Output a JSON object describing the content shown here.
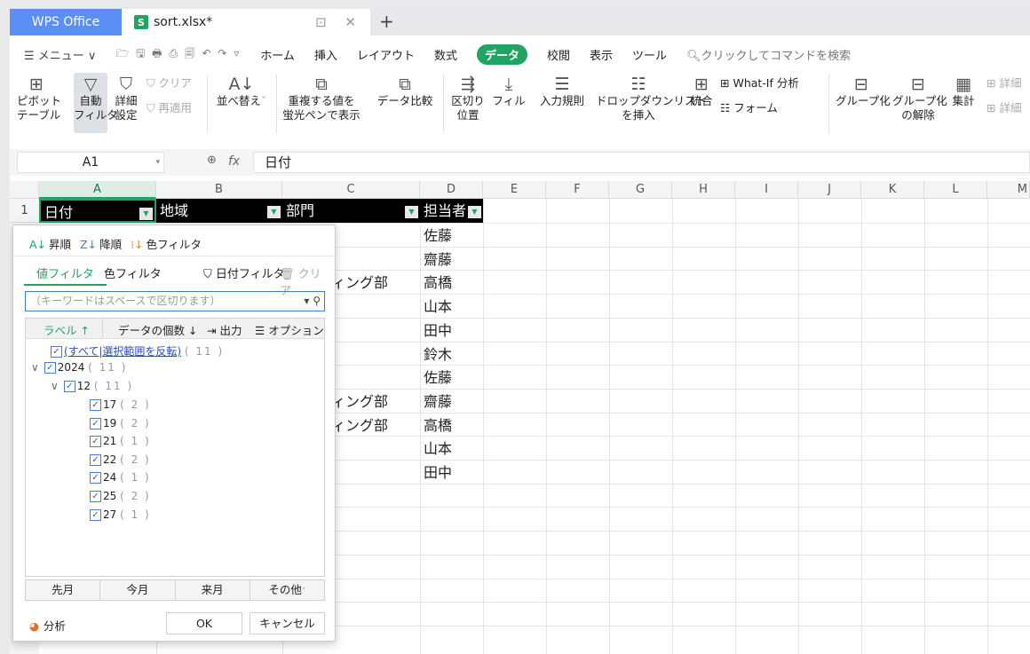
{
  "titlebar": {
    "app_tab": "WPS Office",
    "file_tab": "sort.xlsx*",
    "file_icon_letter": "S",
    "new_tab": "+",
    "tab_controls": "⊡ ✕"
  },
  "menu": {
    "menu_btn": "☰ メニュー ∨",
    "quick_icons": "🗁 🖫 🖶 ⎙ 🗐 ↶ ↷ ▿",
    "items": [
      "ホーム",
      "挿入",
      "レイアウト",
      "数式"
    ],
    "active": "データ",
    "items2": [
      "校閲",
      "表示",
      "ツール"
    ],
    "search": "クリックしてコマンドを検索"
  },
  "ribbon": {
    "pivot": "ピボット\nテーブル",
    "autofilter": "自動\nフィルタ",
    "detail": "詳細\n設定",
    "clear": "クリア",
    "reapply": "再適用",
    "sort": "並べ替え",
    "dup": "重複する値を\n蛍光ペンで表示",
    "compare": "データ比較",
    "split": "区切り\n位置",
    "fill": "フィル",
    "validation": "入力規則",
    "dropdown": "ドロップダウンリスト\nを挿入",
    "consolidate": "統合",
    "whatif": "What-If 分析",
    "form": "フォーム",
    "group": "グループ化",
    "ungroup": "グループ化\nの解除",
    "subtotal": "集計",
    "detail_r": "詳細"
  },
  "formula": {
    "cell": "A1",
    "fx": "fx",
    "value": "日付"
  },
  "columns": [
    "A",
    "B",
    "C",
    "D",
    "E",
    "F",
    "G",
    "H",
    "I",
    "J",
    "K",
    "L",
    "M"
  ],
  "rows": [
    "1"
  ],
  "header": {
    "a": "日付",
    "b": "地域",
    "c": "部門",
    "d": "担当者"
  },
  "col_c_values": [
    "",
    "",
    "ィング部",
    "",
    "",
    "",
    "",
    "ィング部",
    "ィング部",
    "",
    ""
  ],
  "col_d_values": [
    "佐藤",
    "齋藤",
    "高橋",
    "山本",
    "田中",
    "鈴木",
    "佐藤",
    "齋藤",
    "高橋",
    "山本",
    "田中"
  ],
  "filter": {
    "asc": "昇順",
    "desc": "降順",
    "color": "色フィルタ",
    "tab_value": "値フィルタ",
    "tab_color": "色フィルタ",
    "date_filter": "日付フィルタ",
    "clear": "クリア",
    "search_placeholder": "（キーワードはスペースで区切ります）",
    "list_label": "ラベル ↑",
    "list_count": "データの個数 ↓",
    "list_export": "出力",
    "list_options": "オプション",
    "all": "(すべて|選択範囲を反転)",
    "all_count": "( 11 )",
    "year": "2024",
    "year_count": "( 11 )",
    "month": "12",
    "month_count": "( 11 )",
    "days": [
      {
        "d": "17",
        "c": "( 2 )"
      },
      {
        "d": "19",
        "c": "( 2 )"
      },
      {
        "d": "21",
        "c": "( 1 )"
      },
      {
        "d": "22",
        "c": "( 2 )"
      },
      {
        "d": "24",
        "c": "( 1 )"
      },
      {
        "d": "25",
        "c": "( 2 )"
      },
      {
        "d": "27",
        "c": "( 1 )"
      }
    ],
    "quick": [
      "先月",
      "今月",
      "来月",
      "その他"
    ],
    "analysis": "分析",
    "ok": "OK",
    "cancel": "キャンセル"
  },
  "colors": {
    "accent": "#1fa463",
    "wps_blue": "#5b8ff5"
  }
}
